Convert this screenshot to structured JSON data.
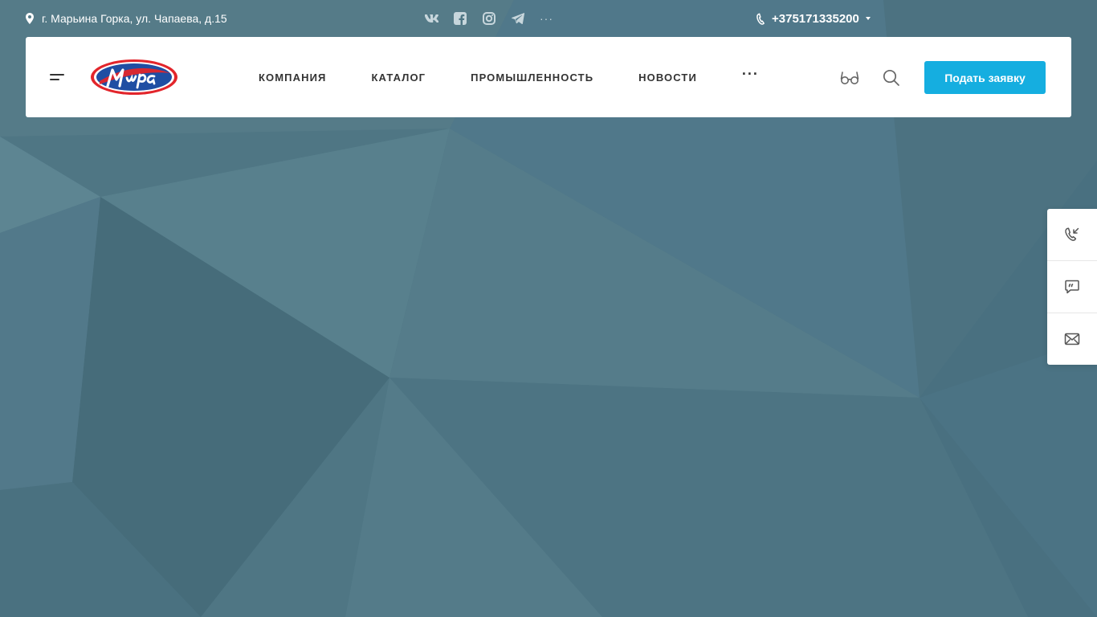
{
  "topbar": {
    "address": "г. Марьина Горка, ул. Чапаева, д.15",
    "socials": [
      {
        "icon": "vk-icon"
      },
      {
        "icon": "facebook-icon"
      },
      {
        "icon": "instagram-icon"
      },
      {
        "icon": "telegram-icon"
      }
    ],
    "socials_more": "···",
    "phone": "+375171335200"
  },
  "header": {
    "logo_text": "Мира",
    "nav": [
      {
        "label": "КОМПАНИЯ"
      },
      {
        "label": "КАТАЛОГ"
      },
      {
        "label": "ПРОМЫШЛЕННОСТЬ"
      },
      {
        "label": "НОВОСТИ"
      }
    ],
    "nav_more": "···",
    "cta_label": "Подать заявку"
  },
  "side_widget": {
    "items": [
      {
        "icon": "callback-phone-icon"
      },
      {
        "icon": "chat-quote-icon"
      },
      {
        "icon": "mail-icon"
      }
    ]
  },
  "colors": {
    "background": "#4f7684",
    "accent": "#15aee0",
    "logo_red": "#e2252b",
    "logo_blue": "#1f4ea3",
    "text_dark": "#333333"
  }
}
